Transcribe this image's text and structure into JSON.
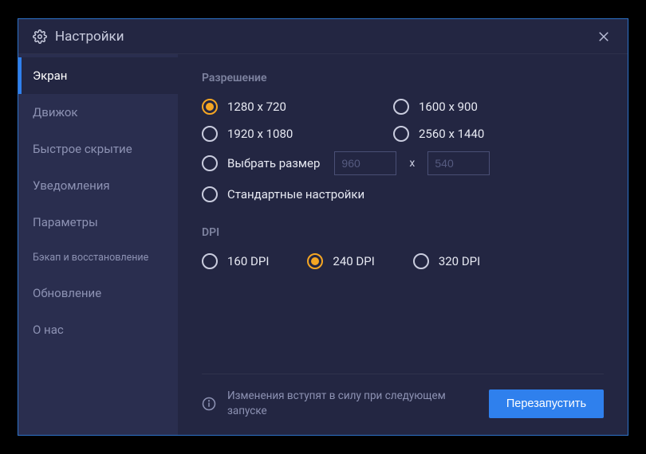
{
  "window": {
    "title": "Настройки"
  },
  "sidebar": {
    "items": [
      {
        "label": "Экран",
        "active": true
      },
      {
        "label": "Движок",
        "active": false
      },
      {
        "label": "Быстрое скрытие",
        "active": false
      },
      {
        "label": "Уведомления",
        "active": false
      },
      {
        "label": "Параметры",
        "active": false
      },
      {
        "label": "Бэкап и восстановление",
        "active": false,
        "small": true
      },
      {
        "label": "Обновление",
        "active": false
      },
      {
        "label": "О нас",
        "active": false
      }
    ]
  },
  "resolution": {
    "heading": "Разрешение",
    "options": [
      {
        "label": "1280 х 720",
        "selected": true
      },
      {
        "label": "1600 х 900",
        "selected": false
      },
      {
        "label": "1920 х 1080",
        "selected": false
      },
      {
        "label": "2560 х 1440",
        "selected": false
      }
    ],
    "custom": {
      "label": "Выбрать размер",
      "width_placeholder": "960",
      "height_placeholder": "540",
      "separator": "x"
    },
    "standard_label": "Стандартные настройки"
  },
  "dpi": {
    "heading": "DPI",
    "options": [
      {
        "label": "160 DPI",
        "selected": false
      },
      {
        "label": "240 DPI",
        "selected": true
      },
      {
        "label": "320 DPI",
        "selected": false
      }
    ]
  },
  "footer": {
    "notice": "Изменения вступят в силу при следующем запуске",
    "restart_label": "Перезапустить"
  }
}
